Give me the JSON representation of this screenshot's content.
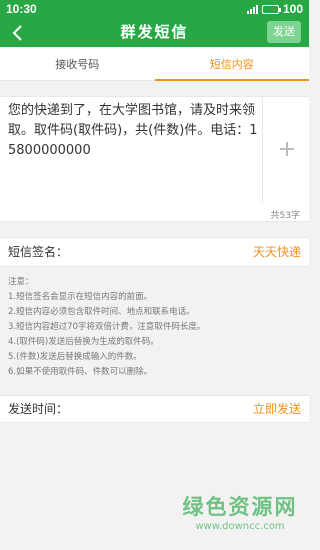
{
  "status_bar": {
    "time": "10:30",
    "battery": "100",
    "battery_level": 1.0
  },
  "header": {
    "title": "群发短信",
    "send_label": "发送"
  },
  "tabs": [
    {
      "label": "接收号码",
      "active": false
    },
    {
      "label": "短信内容",
      "active": true
    }
  ],
  "message": {
    "text": "您的快递到了，在大学图书馆，请及时来领取。取件码(取件码)，共(件数)件。电话：15800000000",
    "char_count": "共53字"
  },
  "signature": {
    "label": "短信签名：",
    "value": "天天快递"
  },
  "notes": {
    "title": "注意：",
    "items": [
      "1.短信签名会显示在短信内容的前面。",
      "2.短信内容必须包含取件时间、地点和联系电话。",
      "3.短信内容超过70字将双倍计费，注意取件码长度。",
      "4.(取件码)发送后替换为生成的取件码。",
      "5.(件数)发送后替换成输入的件数。",
      "6.如果不使用取件码、件数可以删除。"
    ]
  },
  "send_time": {
    "label": "发送时间：",
    "value": "立即发送"
  },
  "watermark": {
    "line1": "绿色资源网",
    "line2": "www.downcc.com"
  },
  "colors": {
    "primary": "#28a745",
    "accent": "#f39019",
    "send_button": "#7dd38f"
  }
}
